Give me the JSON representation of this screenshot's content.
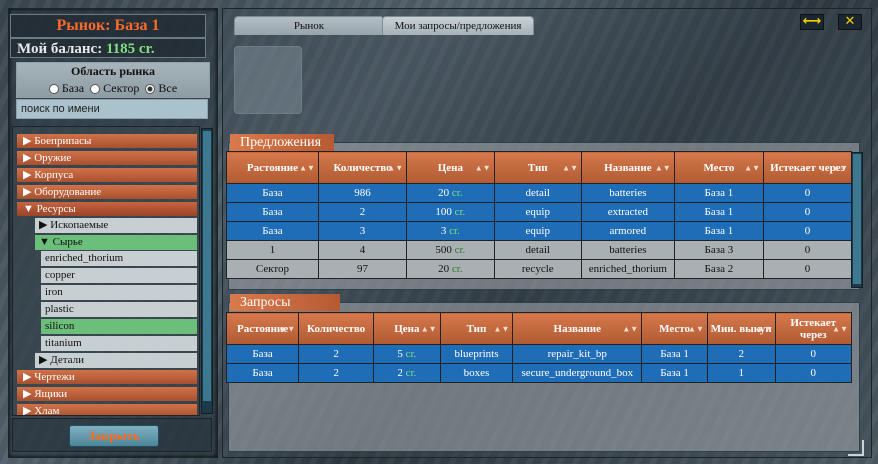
{
  "window": {
    "title": "Рынок: База 1"
  },
  "balance": {
    "label": "Мой баланс:",
    "amount": "1185 cr."
  },
  "area": {
    "title": "Область рынка",
    "options": [
      "База",
      "Сектор",
      "Все"
    ],
    "selected": "Все"
  },
  "search": {
    "placeholder": "поиск по имени"
  },
  "tree": {
    "categories": [
      "Боеприпасы",
      "Оружие",
      "Корпуса",
      "Оборудование",
      "Ресурсы",
      "Чертежи",
      "Ящики",
      "Хлам"
    ],
    "open_category": "Ресурсы",
    "subcategories": [
      "Ископаемые",
      "Сырье",
      "Детали"
    ],
    "open_subcategory": "Сырье",
    "items": [
      "enriched_thorium",
      "copper",
      "iron",
      "plastic",
      "silicon",
      "titanium"
    ],
    "selected_item": "silicon"
  },
  "close_button": "Закрыть",
  "tabs": [
    "Рынок",
    "Мои запросы/предложения"
  ],
  "active_tab": "Мои запросы/предложения",
  "icons": {
    "resize": "expand-horizontal-icon",
    "close": "close-icon"
  },
  "offers": {
    "title": "Предложения",
    "columns": [
      "Растояние",
      "Количество",
      "Цена",
      "Тип",
      "Название",
      "Место",
      "Истекает через"
    ],
    "rows": [
      {
        "distance": "База",
        "qty": "986",
        "price": "20",
        "currency": "cr.",
        "type": "detail",
        "name": "batteries",
        "place": "База 1",
        "expires": "0"
      },
      {
        "distance": "База",
        "qty": "2",
        "price": "100",
        "currency": "cr.",
        "type": "equip",
        "name": "extracted",
        "place": "База 1",
        "expires": "0"
      },
      {
        "distance": "База",
        "qty": "3",
        "price": "3",
        "currency": "cr.",
        "type": "equip",
        "name": "armored",
        "place": "База 1",
        "expires": "0"
      },
      {
        "distance": "1",
        "qty": "4",
        "price": "500",
        "currency": "cr.",
        "type": "detail",
        "name": "batteries",
        "place": "База 3",
        "expires": "0"
      },
      {
        "distance": "Сектор",
        "qty": "97",
        "price": "20",
        "currency": "cr.",
        "type": "recycle",
        "name": "enriched_thorium",
        "place": "База 2",
        "expires": "0"
      }
    ]
  },
  "requests": {
    "title": "Запросы",
    "columns": [
      "Растояние",
      "Количество",
      "Цена",
      "Тип",
      "Название",
      "Место",
      "Мин. выкуп",
      "Истекает через"
    ],
    "rows": [
      {
        "distance": "База",
        "qty": "2",
        "price": "5",
        "currency": "cr.",
        "type": "blueprints",
        "name": "repair_kit_bp",
        "place": "База 1",
        "min": "2",
        "expires": "0"
      },
      {
        "distance": "База",
        "qty": "2",
        "price": "2",
        "currency": "cr.",
        "type": "boxes",
        "name": "secure_underground_box",
        "place": "База 1",
        "min": "1",
        "expires": "0"
      }
    ]
  },
  "colors": {
    "accent": "#ff6a2a",
    "header": "#c8673e",
    "row_blue": "#1f6db6",
    "row_grey": "#a8b0b3",
    "currency": "#7fe07f"
  }
}
